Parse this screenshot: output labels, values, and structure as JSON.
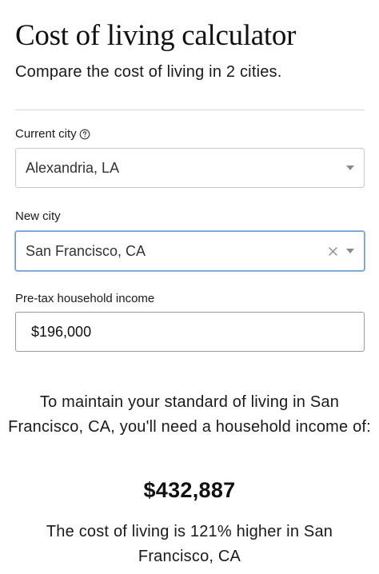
{
  "header": {
    "title": "Cost of living calculator",
    "subtitle": "Compare the cost of living in 2 cities."
  },
  "form": {
    "current_city": {
      "label": "Current city",
      "value": "Alexandria, LA",
      "help_icon": "question-circle-icon"
    },
    "new_city": {
      "label": "New city",
      "value": "San Francisco, CA",
      "clear_icon": "close-icon",
      "focused": true
    },
    "income": {
      "label": "Pre-tax household income",
      "value": "$196,000"
    }
  },
  "result": {
    "statement": "To maintain your standard of living in San Francisco, CA, you'll need a household income of:",
    "amount": "$432,887",
    "comparison": "The cost of living is 121% higher in San Francisco, CA"
  },
  "colors": {
    "focus_border": "#6d9ed6",
    "input_border": "#c9c9c9",
    "text": "#1a1a1a"
  }
}
